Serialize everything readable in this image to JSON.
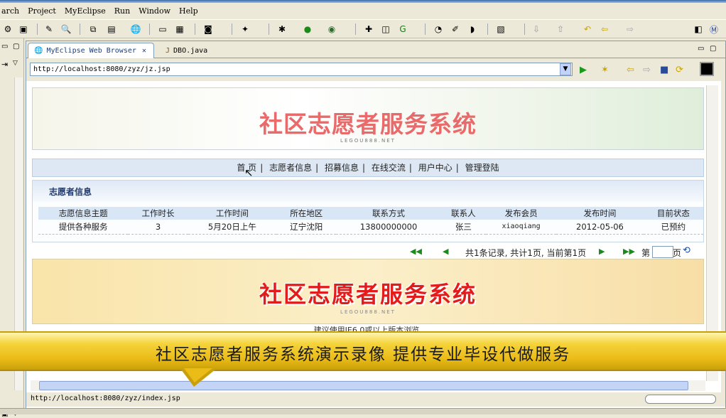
{
  "menu": [
    "arch",
    "Project",
    "MyEclipse",
    "Run",
    "Window",
    "Help"
  ],
  "tabs": [
    {
      "label": "MyEclipse Web Browser",
      "close": "✕"
    },
    {
      "label": "DBO.java"
    }
  ],
  "address": {
    "url": "http://localhost:8080/zyz/jz.jsp"
  },
  "page": {
    "banner_title": "社区志愿者服务系统",
    "banner_sub": "LEGOU888.NET",
    "nav": [
      "首 页",
      "志愿者信息",
      "招募信息",
      "在线交流",
      "用户中心",
      "管理登陆"
    ],
    "section_title": "志愿者信息",
    "table": {
      "headers": [
        "志愿信息主题",
        "工作时长",
        "工作时间",
        "所在地区",
        "联系方式",
        "联系人",
        "发布会员",
        "发布时间",
        "目前状态"
      ],
      "rows": [
        [
          "提供各种服务",
          "3",
          "5月20日上午",
          "辽宁沈阳",
          "13800000000",
          "张三",
          "xiaoqiang",
          "2012-05-06",
          "已预约"
        ]
      ]
    },
    "pager_text": "共1条记录, 共计1页, 当前第1页",
    "pager_page_label": "第",
    "pager_page_suffix": "页",
    "footer_title": "社区志愿者服务系统",
    "footer_sub": "LEGOU888.NET",
    "browser_tip": "建议使用IE6.0或以上版本浏览"
  },
  "status": {
    "url": "http://localhost:8080/zyz/index.jsp"
  },
  "overlay": {
    "caption": "社区志愿者服务系统演示录像  提供专业毕设代做服务"
  },
  "colors": {
    "banner_title": "#e96a6a",
    "footer_title": "#e21c1c",
    "overlay": "#f4d33a"
  }
}
